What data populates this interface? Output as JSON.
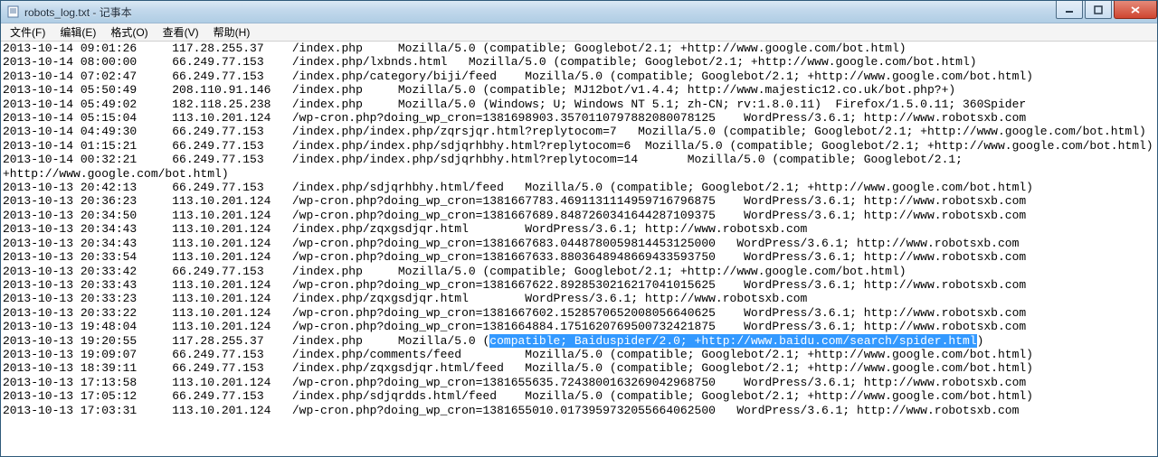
{
  "window": {
    "title": "robots_log.txt - 记事本"
  },
  "menu": {
    "file": "文件(F)",
    "edit": "编辑(E)",
    "format": "格式(O)",
    "view": "查看(V)",
    "help": "帮助(H)"
  },
  "selection": {
    "text": "compatible; Baiduspider/2.0; +http://www.baidu.com/search/spider.html"
  },
  "log_lines": [
    "2013-10-14 09:01:26     117.28.255.37    /index.php     Mozilla/5.0 (compatible; Googlebot/2.1; +http://www.google.com/bot.html)",
    "2013-10-14 08:00:00     66.249.77.153    /index.php/lxbnds.html   Mozilla/5.0 (compatible; Googlebot/2.1; +http://www.google.com/bot.html)",
    "2013-10-14 07:02:47     66.249.77.153    /index.php/category/biji/feed    Mozilla/5.0 (compatible; Googlebot/2.1; +http://www.google.com/bot.html)",
    "2013-10-14 05:50:49     208.110.91.146   /index.php     Mozilla/5.0 (compatible; MJ12bot/v1.4.4; http://www.majestic12.co.uk/bot.php?+)",
    "2013-10-14 05:49:02     182.118.25.238   /index.php     Mozilla/5.0 (Windows; U; Windows NT 5.1; zh-CN; rv:1.8.0.11)  Firefox/1.5.0.11; 360Spider",
    "2013-10-14 05:15:04     113.10.201.124   /wp-cron.php?doing_wp_cron=1381698903.3570110797882080078125    WordPress/3.6.1; http://www.robotsxb.com",
    "2013-10-14 04:49:30     66.249.77.153    /index.php/index.php/zqrsjqr.html?replytocom=7   Mozilla/5.0 (compatible; Googlebot/2.1; +http://www.google.com/bot.html)",
    "2013-10-14 01:15:21     66.249.77.153    /index.php/index.php/sdjqrhbhy.html?replytocom=6  Mozilla/5.0 (compatible; Googlebot/2.1; +http://www.google.com/bot.html)",
    "2013-10-14 00:32:21     66.249.77.153    /index.php/index.php/sdjqrhbhy.html?replytocom=14       Mozilla/5.0 (compatible; Googlebot/2.1;",
    "+http://www.google.com/bot.html)",
    "2013-10-13 20:42:13     66.249.77.153    /index.php/sdjqrhbhy.html/feed   Mozilla/5.0 (compatible; Googlebot/2.1; +http://www.google.com/bot.html)",
    "2013-10-13 20:36:23     113.10.201.124   /wp-cron.php?doing_wp_cron=1381667783.4691131114959716796875    WordPress/3.6.1; http://www.robotsxb.com",
    "2013-10-13 20:34:50     113.10.201.124   /wp-cron.php?doing_wp_cron=1381667689.8487260341644287109375    WordPress/3.6.1; http://www.robotsxb.com",
    "2013-10-13 20:34:43     113.10.201.124   /index.php/zqxgsdjqr.html        WordPress/3.6.1; http://www.robotsxb.com",
    "2013-10-13 20:34:43     113.10.201.124   /wp-cron.php?doing_wp_cron=1381667683.0448780059814453125000   WordPress/3.6.1; http://www.robotsxb.com",
    "2013-10-13 20:33:54     113.10.201.124   /wp-cron.php?doing_wp_cron=1381667633.8803648948669433593750    WordPress/3.6.1; http://www.robotsxb.com",
    "2013-10-13 20:33:42     66.249.77.153    /index.php     Mozilla/5.0 (compatible; Googlebot/2.1; +http://www.google.com/bot.html)",
    "2013-10-13 20:33:43     113.10.201.124   /wp-cron.php?doing_wp_cron=1381667622.8928530216217041015625    WordPress/3.6.1; http://www.robotsxb.com",
    "2013-10-13 20:33:23     113.10.201.124   /index.php/zqxgsdjqr.html        WordPress/3.6.1; http://www.robotsxb.com",
    "2013-10-13 20:33:22     113.10.201.124   /wp-cron.php?doing_wp_cron=1381667602.1528570652008056640625    WordPress/3.6.1; http://www.robotsxb.com",
    "2013-10-13 19:48:04     113.10.201.124   /wp-cron.php?doing_wp_cron=1381664884.1751620769500732421875    WordPress/3.6.1; http://www.robotsxb.com",
    "2013-10-13 19:20:55     117.28.255.37    /index.php     Mozilla/5.0 (__SEL__)",
    "2013-10-13 19:09:07     66.249.77.153    /index.php/comments/feed         Mozilla/5.0 (compatible; Googlebot/2.1; +http://www.google.com/bot.html)",
    "2013-10-13 18:39:11     66.249.77.153    /index.php/zqxgsdjqr.html/feed   Mozilla/5.0 (compatible; Googlebot/2.1; +http://www.google.com/bot.html)",
    "2013-10-13 17:13:58     113.10.201.124   /wp-cron.php?doing_wp_cron=1381655635.7243800163269042968750    WordPress/3.6.1; http://www.robotsxb.com",
    "2013-10-13 17:05:12     66.249.77.153    /index.php/sdjqrdds.html/feed    Mozilla/5.0 (compatible; Googlebot/2.1; +http://www.google.com/bot.html)",
    "2013-10-13 17:03:31     113.10.201.124   /wp-cron.php?doing_wp_cron=1381655010.0173959732055664062500   WordPress/3.6.1; http://www.robotsxb.com"
  ]
}
